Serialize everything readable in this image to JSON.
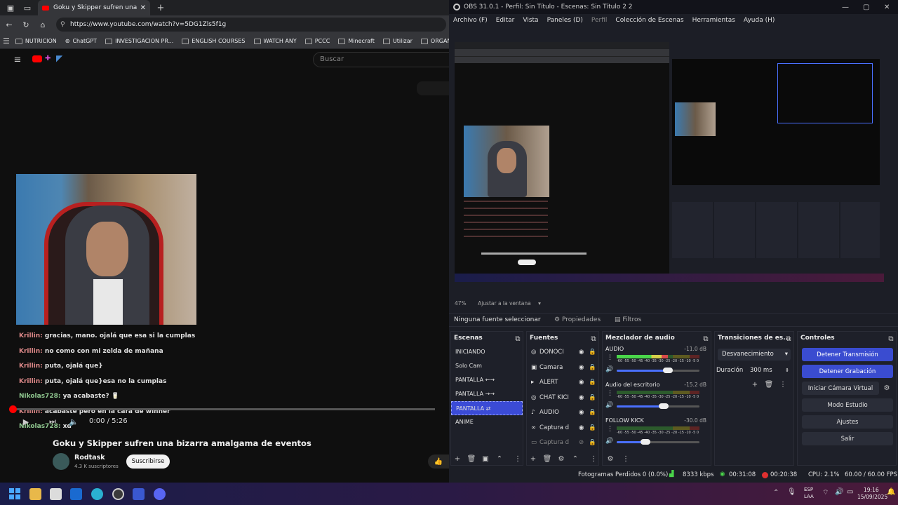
{
  "browser": {
    "tab_title": "Goku y Skipper sufren una bizarr...",
    "url": "https://www.youtube.com/watch?v=5DG1Zls5f1g",
    "bookmarks": [
      "NUTRICION",
      "ChatGPT",
      "INVESTIGACION PR...",
      "ENGLISH COURSES",
      "WATCH ANY",
      "PCCC",
      "Minecraft",
      "Utilizar",
      "ORGANIZACI"
    ],
    "search_placeholder": "Buscar"
  },
  "video": {
    "time": "0:00 / 5:26",
    "title": "Goku y Skipper sufren una bizarra amalgama de eventos",
    "channel": "Rodtask",
    "subscribers": "4.3 K suscriptores",
    "subscribe_label": "Suscribirse"
  },
  "chat": [
    {
      "user": "Krillin:",
      "msg": "gracias, mano. ojalá que esa si la cumplas",
      "color": "red"
    },
    {
      "user": "Krillin:",
      "msg": "no como con mi zelda de mañana",
      "color": "red"
    },
    {
      "user": "Krillin:",
      "msg": "puta, ojalá que}",
      "color": "red"
    },
    {
      "user": "Krillin:",
      "msg": "puta, ojalá que}esa no la cumplas",
      "color": "red"
    },
    {
      "user": "Nikolas728:",
      "msg": "ya acabaste? 🥛",
      "color": "green"
    },
    {
      "user": "Krillin:",
      "msg": "acabaste pero en la cara de winner",
      "color": "red"
    },
    {
      "user": "Nikolas728:",
      "msg": "xd",
      "color": "green"
    }
  ],
  "obs": {
    "title": "OBS 31.0.1 - Perfil: Sin Título - Escenas: Sin Título 2 2",
    "menu": [
      "Archivo (F)",
      "Editar",
      "Vista",
      "Paneles (D)",
      "Perfil",
      "Colección de Escenas",
      "Herramientas",
      "Ayuda (H)"
    ],
    "zoom": "47%",
    "zoom_mode": "Ajustar a la ventana",
    "no_source": "Ninguna fuente seleccionar",
    "properties_label": "Propiedades",
    "filters_label": "Filtros",
    "docks": {
      "scenes": "Escenas",
      "sources": "Fuentes",
      "mixer": "Mezclador de audio",
      "transitions": "Transiciones de es...",
      "controls": "Controles"
    },
    "scenes": [
      "INICIANDO",
      "Solo Cam",
      "PANTALLA ←→",
      "PANTALLA →→",
      "PANTALLA ⇄",
      "ANIME"
    ],
    "selected_scene_index": 4,
    "sources": [
      {
        "icon": "web-icon",
        "glyph": "◎",
        "name": "DONOCI"
      },
      {
        "icon": "camera-icon",
        "glyph": "▣",
        "name": "Camara"
      },
      {
        "icon": "alert-icon",
        "glyph": "▸",
        "name": "ALERT"
      },
      {
        "icon": "chat-icon",
        "glyph": "◎",
        "name": "CHAT KICI"
      },
      {
        "icon": "mic-icon",
        "glyph": "♪",
        "name": "AUDIO"
      },
      {
        "icon": "capture-icon",
        "glyph": "∞",
        "name": "Captura d"
      },
      {
        "icon": "window-icon",
        "glyph": "▭",
        "name": "Captura d"
      }
    ],
    "mixer": [
      {
        "name": "AUDIO",
        "db": "-11.0 dB",
        "level": 0.62,
        "fader": 0.62
      },
      {
        "name": "Audio del escritorio",
        "db": "-15.2 dB",
        "level": 0.0,
        "fader": 0.57
      },
      {
        "name": "FOLLOW KICK",
        "db": "-30.0 dB",
        "level": 0.0,
        "fader": 0.35
      }
    ],
    "meter_scale": "-60 -55 -50 -45 -40 -35 -30 -25 -20 -15 -10 -5 0",
    "transition": "Desvanecimiento",
    "duration_label": "Duración",
    "duration": "300 ms",
    "controls": {
      "stop_stream": "Detener Transmisión",
      "stop_record": "Detener Grabación",
      "virtual_cam": "Iniciar Cámara Virtual",
      "studio": "Modo Estudio",
      "settings": "Ajustes",
      "exit": "Salir"
    },
    "status": {
      "dropped": "Fotogramas Perdidos 0 (0.0%)",
      "bitrate": "8333 kbps",
      "stream_time": "00:31:08",
      "rec_time": "00:20:38",
      "cpu": "CPU: 2.1%",
      "fps": "60.00 / 60.00 FPS"
    }
  },
  "taskbar": {
    "lang": "ESP",
    "lang2": "LAA",
    "time": "19:16",
    "date": "15/09/2025"
  },
  "colors": {
    "accent_blue": "#3a4cd0",
    "live_red": "#e03030",
    "yt_red": "#ff0000"
  }
}
